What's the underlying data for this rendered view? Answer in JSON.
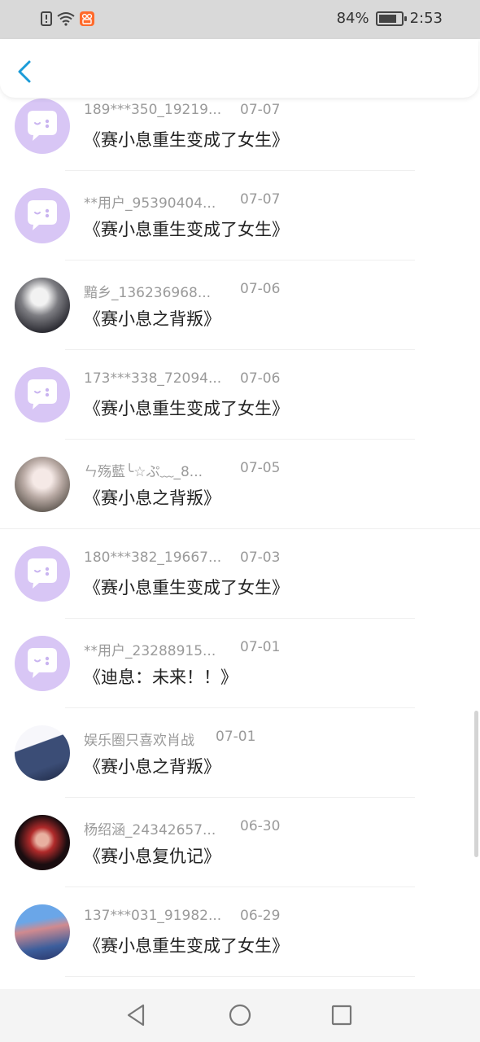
{
  "status_bar": {
    "battery_percent": "84%",
    "battery_level": 0.84,
    "time": "2:53",
    "icons": [
      "alert-icon",
      "wifi-icon",
      "app-notification-icon",
      "charging-battery-icon"
    ]
  },
  "header": {
    "back_icon": "chevron-left-icon"
  },
  "colors": {
    "accent": "#1a9bd8",
    "chat_avatar_bg": "#d8c6f5",
    "chat_bubble": "#ffffff"
  },
  "items": [
    {
      "user": "189***350_19219...",
      "date": "07-07",
      "title": "《赛小息重生变成了女生》",
      "avatar": "chat-bubble-avatar"
    },
    {
      "user": "**用户_95390404...",
      "date": "07-07",
      "title": "《赛小息重生变成了女生》",
      "avatar": "chat-bubble-avatar"
    },
    {
      "user": "黯乡_136236968...",
      "date": "07-06",
      "title": "《赛小息之背叛》",
      "avatar": "photo-avatar"
    },
    {
      "user": "173***338_72094...",
      "date": "07-06",
      "title": "《赛小息重生变成了女生》",
      "avatar": "chat-bubble-avatar"
    },
    {
      "user": "ㄣ殇藍╰☆ぷ﹏_8...",
      "date": "07-05",
      "title": "《赛小息之背叛》",
      "avatar": "photo-avatar"
    },
    {
      "user": "180***382_19667...",
      "date": "07-03",
      "title": "《赛小息重生变成了女生》",
      "avatar": "chat-bubble-avatar"
    },
    {
      "user": "**用户_23288915...",
      "date": "07-01",
      "title": "《迪息：未来！！》",
      "avatar": "chat-bubble-avatar"
    },
    {
      "user": "娱乐圈只喜欢肖战",
      "date": "07-01",
      "title": "《赛小息之背叛》",
      "avatar": "photo-avatar"
    },
    {
      "user": "杨绍涵_24342657...",
      "date": "06-30",
      "title": "《赛小息复仇记》",
      "avatar": "photo-avatar"
    },
    {
      "user": "137***031_91982...",
      "date": "06-29",
      "title": "《赛小息重生变成了女生》",
      "avatar": "photo-avatar"
    }
  ],
  "nav": {
    "icons": [
      "back-triangle-icon",
      "home-circle-icon",
      "recents-square-icon"
    ]
  }
}
